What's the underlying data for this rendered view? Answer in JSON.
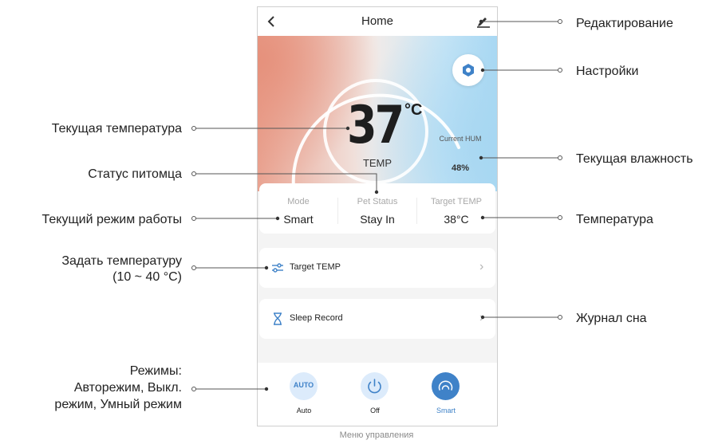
{
  "header": {
    "back_icon": "chevron-left-icon",
    "title": "Home",
    "edit_icon": "edit-pen-icon"
  },
  "hero": {
    "settings_icon": "hexagon-gear-icon",
    "temperature": "37",
    "temperature_unit": "°C",
    "temperature_label": "TEMP",
    "humidity_label": "Current HUM",
    "humidity_value": "48%"
  },
  "status": {
    "mode": {
      "label": "Mode",
      "value": "Smart"
    },
    "pet_status": {
      "label": "Pet Status",
      "value": "Stay In"
    },
    "target_temp": {
      "label": "Target TEMP",
      "value": "38°C"
    }
  },
  "rows": {
    "target_temp": {
      "label": "Target TEMP",
      "icon": "sliders-icon"
    },
    "sleep_record": {
      "label": "Sleep Record",
      "icon": "hourglass-icon"
    }
  },
  "modes": [
    {
      "label": "Auto",
      "icon_text": "AUTO",
      "icon": "auto-icon",
      "active": false
    },
    {
      "label": "Off",
      "icon": "power-icon",
      "active": false
    },
    {
      "label": "Smart",
      "icon": "smart-gauge-icon",
      "active": true
    }
  ],
  "annotations": {
    "edit": "Редактирование",
    "settings": "Настройки",
    "current_temp": "Текущая температура",
    "current_humidity": "Текущая влажность",
    "pet_status": "Статус питомца",
    "current_mode": "Текущий режим работы",
    "temperature": "Температура",
    "set_temp_line1": "Задать температуру",
    "set_temp_line2": "(10 ~ 40 °C)",
    "sleep_log": "Журнал сна",
    "modes_line1": "Режимы:",
    "modes_line2": "Авторежим, Выкл.",
    "modes_line3": "режим, Умный режим"
  },
  "caption": "Меню управления",
  "colors": {
    "accent_blue": "#3f82c8",
    "light_blue_circle": "#dcebfb",
    "text_grey": "#a8a8a8"
  }
}
